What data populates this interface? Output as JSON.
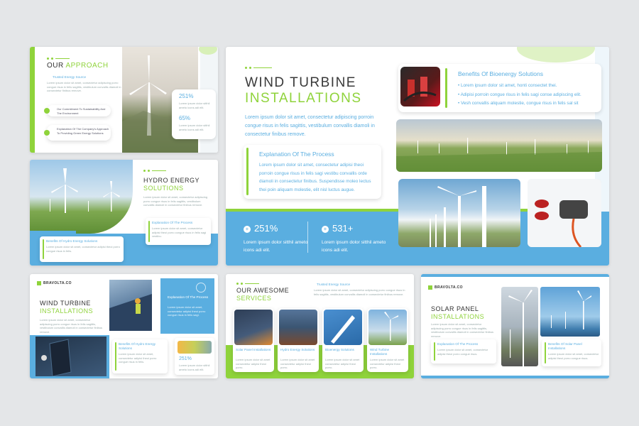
{
  "s1": {
    "title_dark": "OUR",
    "title_accent": "APPROACH",
    "sub": "Trusted Energy Source",
    "body": "Lorem ipsum dolor sit amet, consectetur adipiscing porro congue risus in felis sagittis, vestibulum convallis diamoli in consectetur finibus remove.",
    "item1": "Our Commitment To Sustainability And The Environment",
    "item2": "Explanation Of The Company's Approach To Providing Green Energy Solutions",
    "stat1": "251%",
    "stat2": "65%",
    "stat_text": "Lorem ipsum dolor sitthil ameto icons adi elit."
  },
  "s2": {
    "title_dark": "HYDRO ENERGY",
    "title_accent": "SOLUTIONS",
    "body": "Lorem ipsum dolor sit amet, consectetur adipiscing porro congue risus in felis sagittis, vestibulum convallis diamoli in consectetur finibus remove.",
    "card1_title": "Explanation Of The Process",
    "card1_text": "Lorem ipsum dolor sit amet, consectetur adipisi theoi porro congue risus in felis sagi vestibu.",
    "card2_title": "Benefits Of Hydro Energy Solutions",
    "card2_text": "Lorem ipsum dolor sit amet, consectetur adipisi theoi porro congue risus in felis."
  },
  "main": {
    "title_dark": "WIND TURBINE",
    "title_accent": "INSTALLATIONS",
    "intro": "Lorem ipsum dolor sit amet, consectetur adipiscing porroin congue risus in felis sagittis, vestibulum convallis diamoli in consectetur finibus remove.",
    "process_title": "Explanation Of The Process",
    "process_text": "Lorem ipsum dolor sit amet, consectetur adipisi theoi porroin congue risus in felis sagi vestibu convallis orde diamoli in consectetur finibus. Suspendisse moleo lectus thei poin aliquam molestie, elit nisl luctus augue.",
    "stat1_value": "251%",
    "stat1_text": "Lorem ipsum dolor sitthil ameto icons adi elit.",
    "stat2_value": "531+",
    "stat2_text": "Lorem ipsum dolor sitthil ameto icons adi elit.",
    "bio_title": "Benefits Of Bioenergy Solutions",
    "bio_items": [
      "Lorem ipsum dolor sit amet, honti consectet thei.",
      "Adipisi porroin congue risus in felis sagi conse adipiscing elit.",
      "Vesh convallis aliquam molestie, congue risus in felis sal sit"
    ]
  },
  "s4": {
    "brand": "BRAVOLTA.CO",
    "title_dark": "WIND TURBINE",
    "title_accent": "INSTALLATIONS",
    "body": "Lorem ipsum dolor sit amet, consectetur adipiscing porro congue risus in felis sagittis, vestibulum convallis diamoli in consectetur finibus remove.",
    "panel_title": "Explanation Of The Process",
    "panel_text": "Lorem ipsum dolor sit amet, consectetur adipisi theoi porro congue risus in felis sagi.",
    "card_title": "Benefits Of Hydro Energy Solutions",
    "card_text": "Lorem ipsum dolor sit amet, consectetur adipisi theoi porro congue risus in felis.",
    "stat": "251%",
    "stat_text": "Lorem ipsum dolor sitthil ameto icons adi elit."
  },
  "s5": {
    "title_dark": "OUR AWESOME",
    "title_accent": "SERVICES",
    "tag": "Trusted Energy Source",
    "intro": "Lorem ipsum dolor sit amet, consectetur adipiscing porro congue risus in felis sagittis, vestibulum convallis diamoli in consectetur finibus remove.",
    "services": [
      {
        "title": "Solar Panel Installations",
        "text": "Lorem ipsum dolor sit amet consectetur adipisi theoi porro."
      },
      {
        "title": "Hydro Energy Solutions",
        "text": "Lorem ipsum dolor sit amet consectetur adipisi theoi porro."
      },
      {
        "title": "Bioenergy Solutions",
        "text": "Lorem ipsum dolor sit amet consectetur adipisi theoi porro."
      },
      {
        "title": "Wind Turbine Installations",
        "text": "Lorem ipsum dolor sit amet consectetur adipisi theoi porro."
      }
    ]
  },
  "s6": {
    "brand": "BRAVOLTA.CO",
    "title_dark": "SOLAR PANEL",
    "title_accent": "INSTALLATIONS",
    "body": "Lorem ipsum dolor sit amet, consectetur adipiscing porro congue risus in felis sagittis, vestibulum convallis diamoli in consectetur finibus remove.",
    "card1_title": "Explanation Of The Process",
    "card1_text": "Lorem ipsum dolor sit amet, consectetur adipisi theoi porro congue risus.",
    "card2_title": "Benefits Of Solar Panel Installations",
    "card2_text": "Lorem ipsum dolor sit amet, consectetur adipisi theoi porro congue risus."
  },
  "colors": {
    "accent_green": "#8fd33b",
    "accent_blue": "#5aaee0",
    "background": "#e4e6e8"
  }
}
